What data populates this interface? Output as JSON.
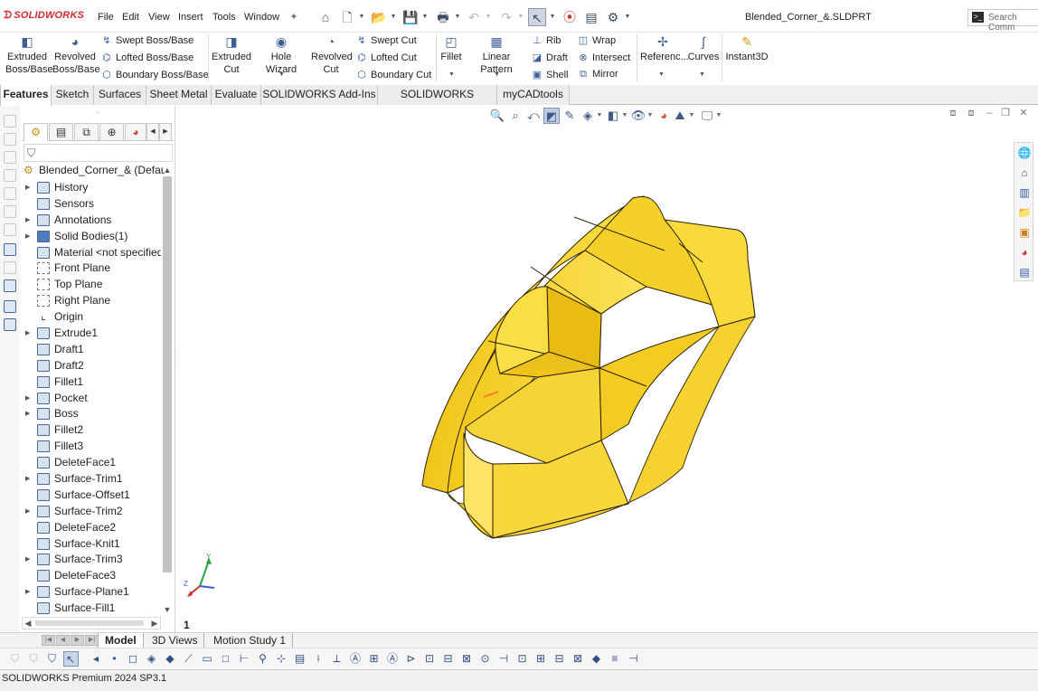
{
  "app": {
    "logo": "SOLIDWORKS",
    "document_title": "Blended_Corner_&.SLDPRT",
    "search_placeholder": "Search Comm"
  },
  "menu": [
    "File",
    "Edit",
    "View",
    "Insert",
    "Tools",
    "Window"
  ],
  "ribbon": {
    "extruded_boss": [
      "Extruded",
      "Boss/Base"
    ],
    "revolved_boss": [
      "Revolved",
      "Boss/Base"
    ],
    "swept_boss": "Swept Boss/Base",
    "lofted_boss": "Lofted Boss/Base",
    "boundary_boss": "Boundary Boss/Base",
    "extruded_cut": [
      "Extruded",
      "Cut"
    ],
    "hole_wizard": "Hole Wizard",
    "revolved_cut": [
      "Revolved",
      "Cut"
    ],
    "swept_cut": "Swept Cut",
    "lofted_cut": "Lofted Cut",
    "boundary_cut": "Boundary Cut",
    "fillet": "Fillet",
    "linear_pattern": "Linear Pattern",
    "rib": "Rib",
    "draft": "Draft",
    "shell": "Shell",
    "wrap": "Wrap",
    "intersect": "Intersect",
    "mirror": "Mirror",
    "reference": "Referenc...",
    "curves": "Curves",
    "instant3d": "Instant3D"
  },
  "tabs": [
    "Features",
    "Sketch",
    "Surfaces",
    "Sheet Metal",
    "Evaluate",
    "SOLIDWORKS Add-Ins",
    "SOLIDWORKS Visualize",
    "myCADtools"
  ],
  "feature_tree": {
    "root": "Blended_Corner_& (Default",
    "items": [
      {
        "label": "History",
        "expandable": true
      },
      {
        "label": "Sensors",
        "expandable": false
      },
      {
        "label": "Annotations",
        "expandable": true
      },
      {
        "label": "Solid Bodies(1)",
        "expandable": true
      },
      {
        "label": "Material <not specified>",
        "expandable": false
      },
      {
        "label": "Front Plane",
        "expandable": false
      },
      {
        "label": "Top Plane",
        "expandable": false
      },
      {
        "label": "Right Plane",
        "expandable": false
      },
      {
        "label": "Origin",
        "expandable": false
      },
      {
        "label": "Extrude1",
        "expandable": true
      },
      {
        "label": "Draft1",
        "expandable": false
      },
      {
        "label": "Draft2",
        "expandable": false
      },
      {
        "label": "Fillet1",
        "expandable": false
      },
      {
        "label": "Pocket",
        "expandable": true
      },
      {
        "label": "Boss",
        "expandable": true
      },
      {
        "label": "Fillet2",
        "expandable": false
      },
      {
        "label": "Fillet3",
        "expandable": false
      },
      {
        "label": "DeleteFace1",
        "expandable": false
      },
      {
        "label": "Surface-Trim1",
        "expandable": true
      },
      {
        "label": "Surface-Offset1",
        "expandable": false
      },
      {
        "label": "Surface-Trim2",
        "expandable": true
      },
      {
        "label": "DeleteFace2",
        "expandable": false
      },
      {
        "label": "Surface-Knit1",
        "expandable": false
      },
      {
        "label": "Surface-Trim3",
        "expandable": true
      },
      {
        "label": "DeleteFace3",
        "expandable": false
      },
      {
        "label": "Surface-Plane1",
        "expandable": true
      },
      {
        "label": "Surface-Fill1",
        "expandable": false
      }
    ]
  },
  "viewport": {
    "sheet_number": "1",
    "model_color": "#f5cc1c",
    "triad_labels": {
      "y": "Y",
      "z": "Z"
    }
  },
  "bottom_tabs": [
    "Model",
    "3D Views",
    "Motion Study 1"
  ],
  "status": {
    "text": "SOLIDWORKS Premium 2024 SP3.1"
  },
  "colors": {
    "accent": "#d4282e",
    "ui_blue": "#3d5f98"
  }
}
